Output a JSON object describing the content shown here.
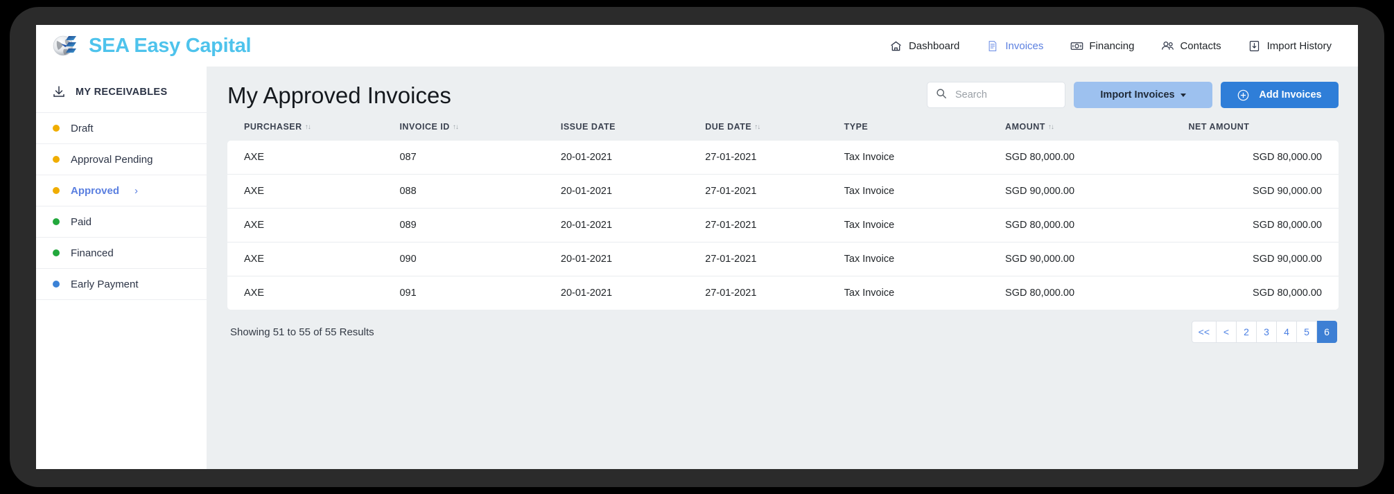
{
  "brand": {
    "name": "SEA Easy Capital",
    "logo_icon": "globe-bars-logo"
  },
  "nav": {
    "items": [
      {
        "label": "Dashboard",
        "icon": "home-icon",
        "active": false
      },
      {
        "label": "Invoices",
        "icon": "document-icon",
        "active": true
      },
      {
        "label": "Financing",
        "icon": "banknote-icon",
        "active": false
      },
      {
        "label": "Contacts",
        "icon": "people-icon",
        "active": false
      },
      {
        "label": "Import History",
        "icon": "import-icon",
        "active": false
      }
    ]
  },
  "sidebar": {
    "title": "MY RECEIVABLES",
    "title_icon": "download-icon",
    "items": [
      {
        "label": "Draft",
        "dot_color": "#f0ad00",
        "active": false
      },
      {
        "label": "Approval Pending",
        "dot_color": "#f0ad00",
        "active": false
      },
      {
        "label": "Approved",
        "dot_color": "#f0ad00",
        "active": true,
        "chevron": "›"
      },
      {
        "label": "Paid",
        "dot_color": "#22a83c",
        "active": false
      },
      {
        "label": "Financed",
        "dot_color": "#22a83c",
        "active": false
      },
      {
        "label": "Early Payment",
        "dot_color": "#3b82d6",
        "active": false
      }
    ]
  },
  "main": {
    "page_title": "My Approved Invoices",
    "search": {
      "placeholder": "Search",
      "value": "",
      "icon": "search-icon"
    },
    "import_button": {
      "label": "Import Invoices",
      "icon": "caret-down-icon"
    },
    "add_button": {
      "label": "Add Invoices",
      "icon": "plus-circle-icon"
    }
  },
  "table": {
    "columns": [
      {
        "label": "PURCHASER",
        "sortable": true,
        "sort_icon": "↑↓",
        "align": "left"
      },
      {
        "label": "INVOICE ID",
        "sortable": true,
        "sort_icon": "↑↓",
        "align": "left"
      },
      {
        "label": "ISSUE DATE",
        "sortable": false,
        "sort_icon": "",
        "align": "left"
      },
      {
        "label": "DUE DATE",
        "sortable": true,
        "sort_icon": "↑↓",
        "align": "left"
      },
      {
        "label": "TYPE",
        "sortable": false,
        "sort_icon": "",
        "align": "left"
      },
      {
        "label": "AMOUNT",
        "sortable": true,
        "sort_icon": "↑↓",
        "align": "left"
      },
      {
        "label": "NET AMOUNT",
        "sortable": false,
        "sort_icon": "",
        "align": "right"
      }
    ],
    "rows": [
      {
        "purchaser": "AXE",
        "invoice_id": "087",
        "issue_date": "20-01-2021",
        "due_date": "27-01-2021",
        "type": "Tax Invoice",
        "amount": "SGD 80,000.00",
        "net_amount": "SGD 80,000.00"
      },
      {
        "purchaser": "AXE",
        "invoice_id": "088",
        "issue_date": "20-01-2021",
        "due_date": "27-01-2021",
        "type": "Tax Invoice",
        "amount": "SGD 90,000.00",
        "net_amount": "SGD 90,000.00"
      },
      {
        "purchaser": "AXE",
        "invoice_id": "089",
        "issue_date": "20-01-2021",
        "due_date": "27-01-2021",
        "type": "Tax Invoice",
        "amount": "SGD 80,000.00",
        "net_amount": "SGD 80,000.00"
      },
      {
        "purchaser": "AXE",
        "invoice_id": "090",
        "issue_date": "20-01-2021",
        "due_date": "27-01-2021",
        "type": "Tax Invoice",
        "amount": "SGD 90,000.00",
        "net_amount": "SGD 90,000.00"
      },
      {
        "purchaser": "AXE",
        "invoice_id": "091",
        "issue_date": "20-01-2021",
        "due_date": "27-01-2021",
        "type": "Tax Invoice",
        "amount": "SGD 80,000.00",
        "net_amount": "SGD 80,000.00"
      }
    ]
  },
  "footer": {
    "showing_text": "Showing 51 to 55 of 55 Results",
    "pagination": [
      {
        "label": "<<",
        "active": false
      },
      {
        "label": "<",
        "active": false
      },
      {
        "label": "2",
        "active": false
      },
      {
        "label": "3",
        "active": false
      },
      {
        "label": "4",
        "active": false
      },
      {
        "label": "5",
        "active": false
      },
      {
        "label": "6",
        "active": true
      }
    ]
  },
  "colors": {
    "brand_cyan": "#4ec3ec",
    "accent_blue": "#2f7ed8",
    "link_blue": "#5a7fe0",
    "page_bg": "#eceff1",
    "import_btn": "#9dc1ef"
  }
}
